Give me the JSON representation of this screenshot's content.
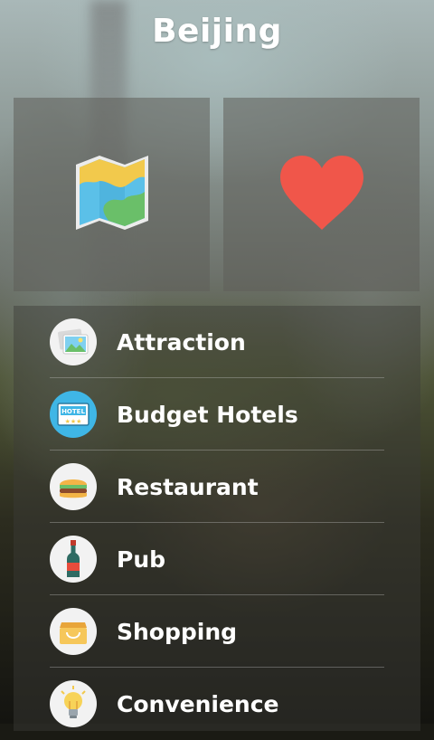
{
  "header": {
    "title": "Beijing"
  },
  "tiles": [
    {
      "icon": "map-icon"
    },
    {
      "icon": "heart-icon",
      "color": "#f0564a"
    }
  ],
  "menu": {
    "items": [
      {
        "label": "Attraction",
        "icon": "photo-icon"
      },
      {
        "label": "Budget Hotels",
        "icon": "hotel-sign-icon"
      },
      {
        "label": "Restaurant",
        "icon": "burger-icon"
      },
      {
        "label": "Pub",
        "icon": "wine-bottle-icon"
      },
      {
        "label": "Shopping",
        "icon": "shopping-bag-icon"
      },
      {
        "label": "Convenience",
        "icon": "lightbulb-icon"
      }
    ]
  }
}
